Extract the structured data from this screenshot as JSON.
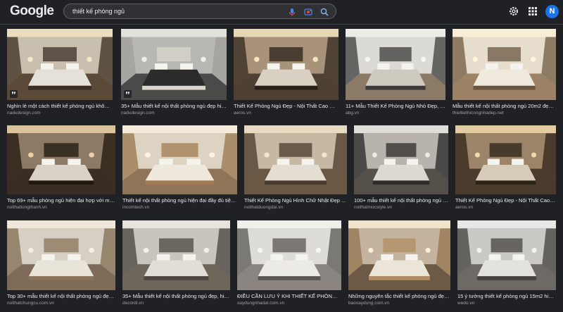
{
  "header": {
    "logo": "Google",
    "search_value": "thiết kế phòng ngủ",
    "avatar_letter": "N",
    "accent": "#1a73e8"
  },
  "results": [
    {
      "title": "Nghìn lẻ một cách thiết kế phòng ngủ không ...",
      "source": "nadudesign.com",
      "badge": "❜❜"
    },
    {
      "title": "35+ Mẫu thiết kế nội thất phòng ngủ đẹp hiện...",
      "source": "nadudesign.com",
      "badge": "❜❜"
    },
    {
      "title": "Thiết Kế Phòng Ngủ Đẹp - Nội Thất Cao Cấp ...",
      "source": "aeros.vn",
      "badge": ""
    },
    {
      "title": "11+ Mẫu Thiết Kế Phòng Ngủ Nhỏ Đẹp, Đã...",
      "source": "abg.vn",
      "badge": ""
    },
    {
      "title": "Mẫu thiết kế nội thất phòng ngủ 20m2 đẹp ...",
      "source": "thietkethicongnhadep.net",
      "badge": ""
    },
    {
      "title": "Top 69+ mẫu phòng ngủ hiện đại hợp với mọi ...",
      "source": "noithatlongthanh.vn",
      "badge": ""
    },
    {
      "title": "Thiết kế nội thất phòng ngủ hiện đại đầy đủ tiện ...",
      "source": "incomtech.vn",
      "badge": ""
    },
    {
      "title": "Thiết Kế Phòng Ngủ Hình Chữ Nhật Đẹp ...",
      "source": "noithatduongdai.vn",
      "badge": ""
    },
    {
      "title": "100+ mẫu thiết kế nội thất phòng ngủ hiện ...",
      "source": "noithatmocstyle.vn",
      "badge": ""
    },
    {
      "title": "Thiết Kế Phòng Ngủ Đẹp - Nội Thất Cao Cấ...",
      "source": "aeros.vn",
      "badge": ""
    },
    {
      "title": "Top 30+ mẫu thiết kế nội thất phòng ngủ đẹp 2...",
      "source": "noithatchungcu.com.vn",
      "badge": ""
    },
    {
      "title": "35+ Mẫu thiết kế nội thất phòng ngủ đẹp, hiện...",
      "source": "decordi.vn",
      "badge": ""
    },
    {
      "title": "ĐIỀU CẦN LƯU Ý KHI THIẾT KẾ PHÒNG NGỦ ...",
      "source": "xaydungnhadat.com.vn",
      "badge": ""
    },
    {
      "title": "Những nguyên tắc thiết kế phòng ngủ đẹp ...",
      "source": "baoxaydung.com.vn",
      "badge": ""
    },
    {
      "title": "15 ý tưởng thiết kế phòng ngủ 15m2 hiện ...",
      "source": "wedo.vn",
      "badge": ""
    }
  ],
  "thumb_images": [
    {
      "main": "#8a7d6a",
      "wall": "#c9bfae",
      "floor": "#5b4a38",
      "bed": "#e6e1d8",
      "accent": "#3a2f25",
      "light": "#f3e7c9"
    },
    {
      "main": "#6b6b6b",
      "wall": "#b7b7b4",
      "floor": "#4a4a48",
      "bed": "#2b2b2b",
      "accent": "#d9d5cc",
      "light": "#eeeeea"
    },
    {
      "main": "#7b6a55",
      "wall": "#a8937a",
      "floor": "#4e4032",
      "bed": "#d8d0c2",
      "accent": "#2a221a",
      "light": "#f2e3c2"
    },
    {
      "main": "#9a9a96",
      "wall": "#dcdad4",
      "floor": "#8a7a66",
      "bed": "#cfcac0",
      "accent": "#3b3b3b",
      "light": "#f7f5ef"
    },
    {
      "main": "#b9a88f",
      "wall": "#e7ddcc",
      "floor": "#9c8366",
      "bed": "#efe9de",
      "accent": "#6a5640",
      "light": "#fff5df"
    },
    {
      "main": "#5b4c3f",
      "wall": "#8d7a66",
      "floor": "#3a2e24",
      "bed": "#d9d2c6",
      "accent": "#20180f",
      "light": "#e9d2a3"
    },
    {
      "main": "#b6a489",
      "wall": "#ddd3c3",
      "floor": "#8f7558",
      "bed": "#efe8dc",
      "accent": "#a07c52",
      "light": "#fbf3e3"
    },
    {
      "main": "#8c7c68",
      "wall": "#c7b8a3",
      "floor": "#6a5744",
      "bed": "#e3ddd2",
      "accent": "#4a3b2c",
      "light": "#f1e4cb"
    },
    {
      "main": "#6e6c69",
      "wall": "#b8b4ad",
      "floor": "#56504a",
      "bed": "#dcd9d3",
      "accent": "#2f2d2b",
      "light": "#ecebe6"
    },
    {
      "main": "#6f5a45",
      "wall": "#9c8468",
      "floor": "#4a3b2c",
      "bed": "#d6cbb9",
      "accent": "#2e2317",
      "light": "#f0d9a8"
    },
    {
      "main": "#a79b8b",
      "wall": "#d6cfc4",
      "floor": "#7d6b57",
      "bed": "#e9e4da",
      "accent": "#8a7458",
      "light": "#f6efe2"
    },
    {
      "main": "#8d8982",
      "wall": "#c9c5bd",
      "floor": "#6f665b",
      "bed": "#e2ded6",
      "accent": "#4b4640",
      "light": "#f1eee8"
    },
    {
      "main": "#a3a29f",
      "wall": "#dedcd7",
      "floor": "#8a8580",
      "bed": "#eceae6",
      "accent": "#5a5752",
      "light": "#f8f7f4"
    },
    {
      "main": "#8e7a63",
      "wall": "#c4b49f",
      "floor": "#6c5a46",
      "bed": "#ebe4d8",
      "accent": "#b08d63",
      "light": "#fbeed4"
    },
    {
      "main": "#8b8986",
      "wall": "#cbc9c5",
      "floor": "#6d6a66",
      "bed": "#e4e2de",
      "accent": "#46433f",
      "light": "#f3f2ef"
    }
  ]
}
